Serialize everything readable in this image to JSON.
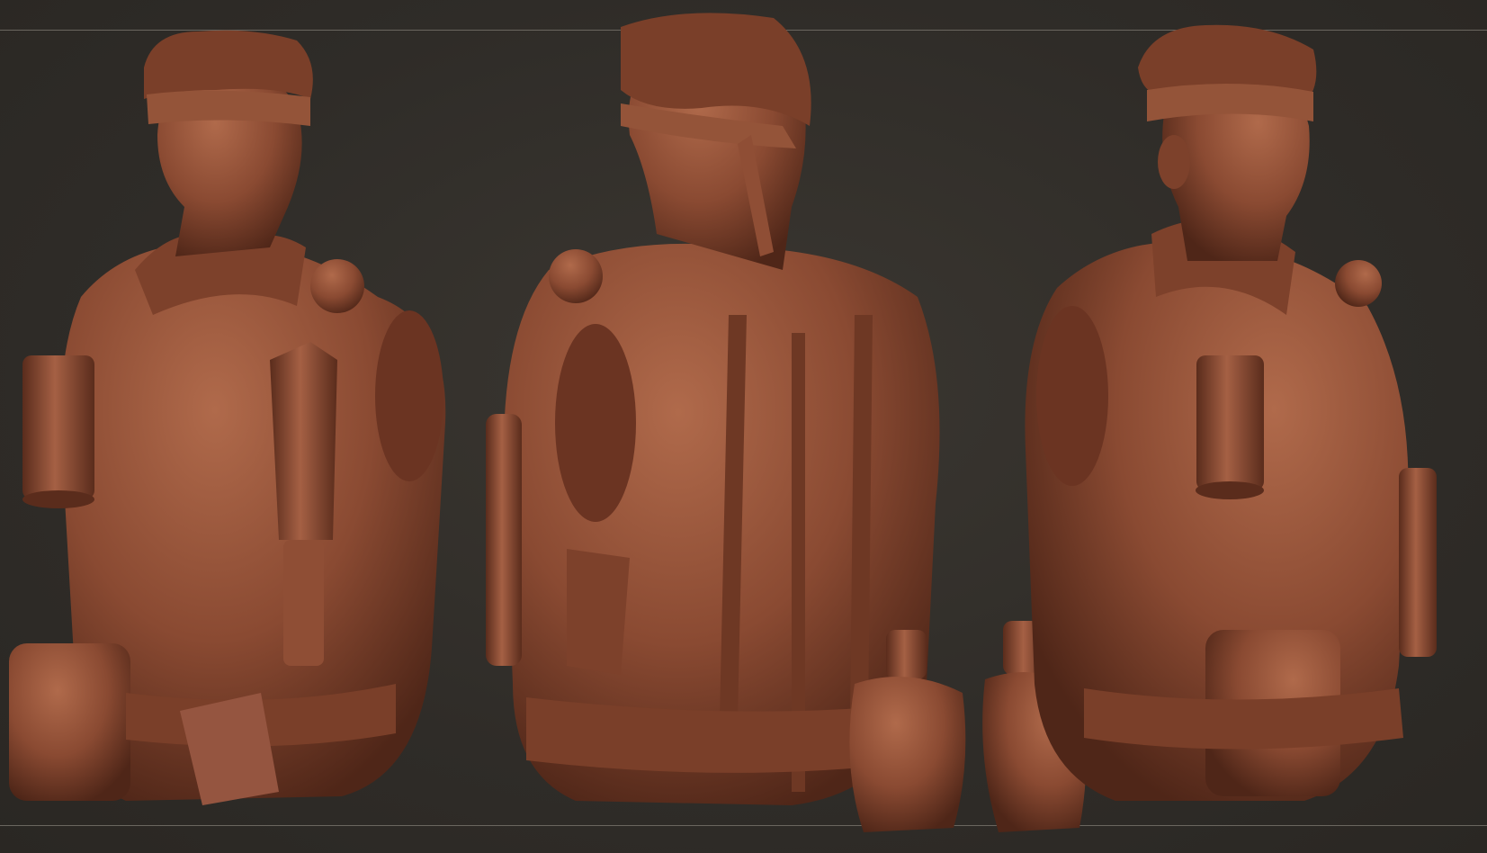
{
  "scene": {
    "background_color": "#2f2c28",
    "clay_color": "#8a4a32",
    "clay_highlight": "#b06a4b",
    "clay_shadow": "#4f2618",
    "frame_line_color": "#6a665f",
    "views": [
      {
        "id": "front-three-quarter-view",
        "subject": "sculpted-bust"
      },
      {
        "id": "back-view",
        "subject": "sculpted-bust"
      },
      {
        "id": "side-three-quarter-view",
        "subject": "sculpted-bust"
      }
    ],
    "props": [
      "canteen-icon",
      "canteen-icon"
    ]
  }
}
